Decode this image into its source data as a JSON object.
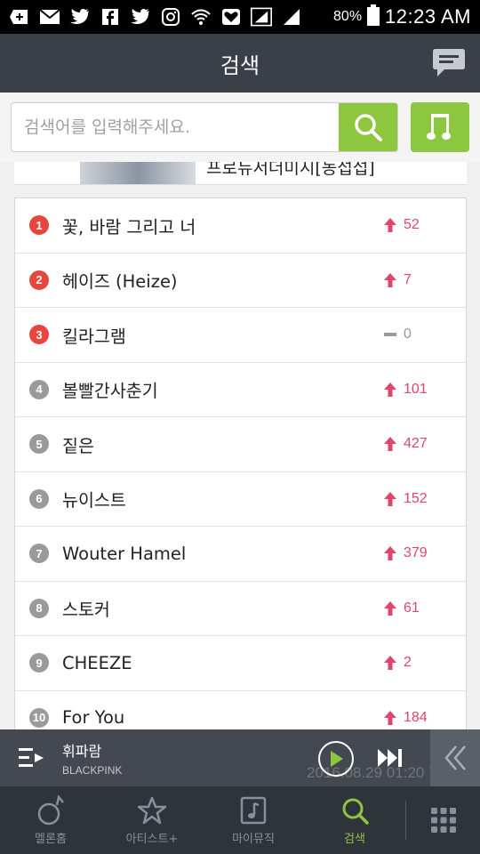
{
  "status": {
    "battery": "80%",
    "time": "12:23 AM"
  },
  "header": {
    "title": "검색"
  },
  "search": {
    "placeholder": "검색어를 입력해주세요."
  },
  "banner": {
    "text": "프로듀서더미시[농섭섭]"
  },
  "ranking": [
    {
      "rank": "1",
      "keyword": "꽃, 바람 그리고 너",
      "trend": "up",
      "change": "52"
    },
    {
      "rank": "2",
      "keyword": "헤이즈 (Heize)",
      "trend": "up",
      "change": "7"
    },
    {
      "rank": "3",
      "keyword": "킬라그램",
      "trend": "same",
      "change": "0"
    },
    {
      "rank": "4",
      "keyword": "볼빨간사춘기",
      "trend": "up",
      "change": "101"
    },
    {
      "rank": "5",
      "keyword": "짙은",
      "trend": "up",
      "change": "427"
    },
    {
      "rank": "6",
      "keyword": "뉴이스트",
      "trend": "up",
      "change": "152"
    },
    {
      "rank": "7",
      "keyword": "Wouter Hamel",
      "trend": "up",
      "change": "379"
    },
    {
      "rank": "8",
      "keyword": "스토커",
      "trend": "up",
      "change": "61"
    },
    {
      "rank": "9",
      "keyword": "CHEEZE",
      "trend": "up",
      "change": "2"
    },
    {
      "rank": "10",
      "keyword": "For You",
      "trend": "up",
      "change": "184"
    }
  ],
  "player": {
    "title": "휘파람",
    "artist": "BLACKPINK",
    "timestamp": "2016.08.29 01:20 현재"
  },
  "tabs": [
    {
      "label": "멜론홈",
      "icon": "melon-home-icon"
    },
    {
      "label": "아티스트+",
      "icon": "star-icon"
    },
    {
      "label": "마이뮤직",
      "icon": "my-music-icon"
    },
    {
      "label": "검색",
      "icon": "search-icon"
    }
  ],
  "colors": {
    "accent": "#8dc63f",
    "header_bg": "#3a4048",
    "rank_top": "#e8453c",
    "rank_other": "#9a9a9a",
    "trend_up": "#e0456b"
  }
}
